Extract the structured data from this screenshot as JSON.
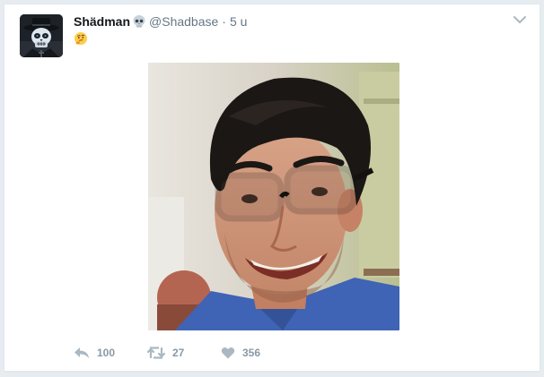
{
  "tweet": {
    "author": {
      "fullname": "Shädman",
      "handle": "@Shadbase",
      "separator": "·",
      "time": "5 u",
      "name_emoji": "skull-icon",
      "avatar": "avatar-skull-hat"
    },
    "content": {
      "emoji": "thinking-face-icon",
      "media": "photo-smiling-man-glasses"
    },
    "actions": {
      "reply_count": "100",
      "retweet_count": "27",
      "like_count": "356"
    },
    "menu_icon": "chevron-down-icon"
  },
  "colors": {
    "background": "#e6ecf0",
    "card": "#ffffff",
    "name": "#14171a",
    "muted": "#657786",
    "action": "#8899a6",
    "border": "#e1e8ed"
  }
}
